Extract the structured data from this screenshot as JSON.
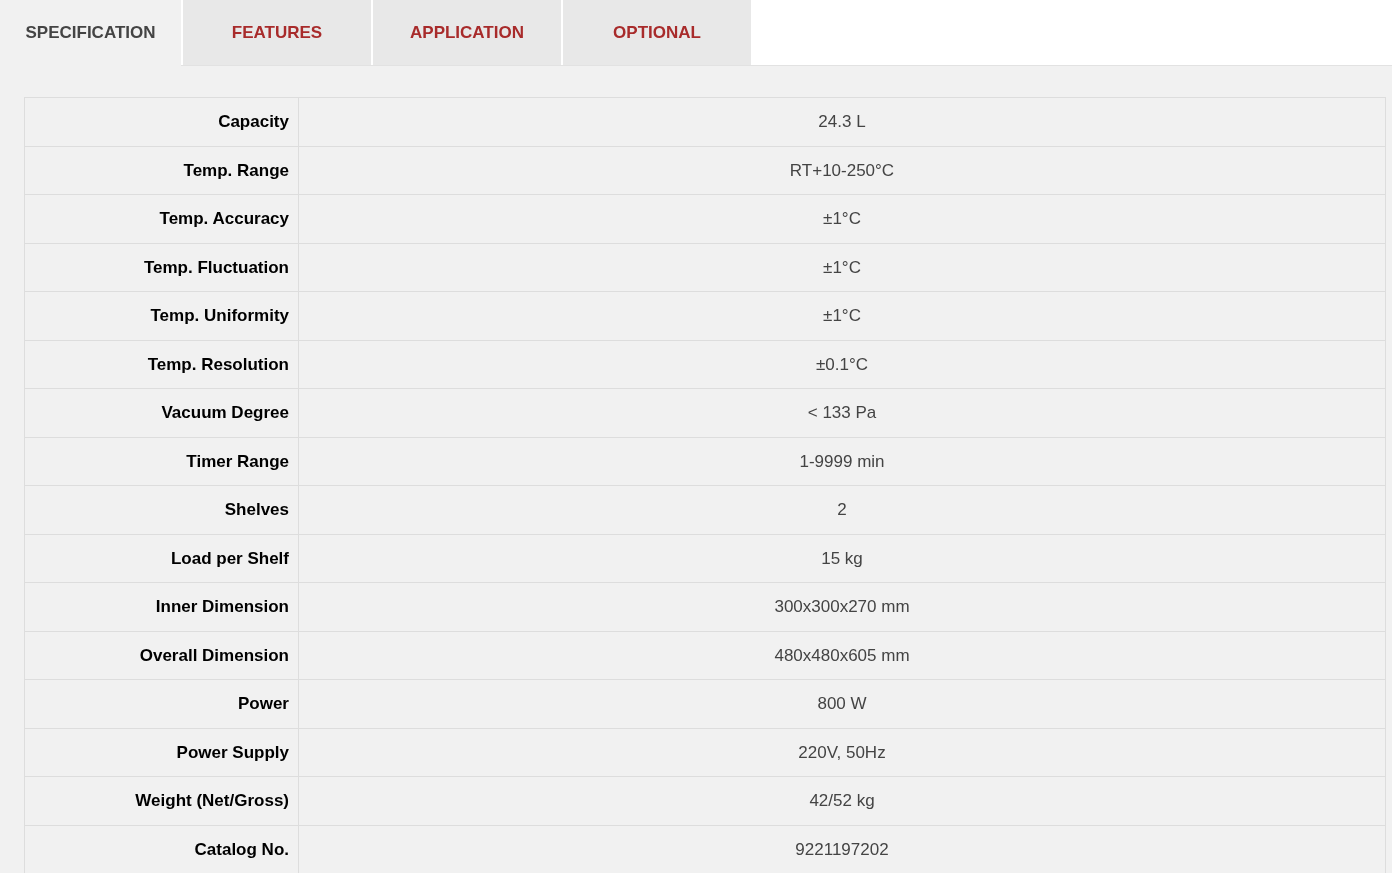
{
  "tabs": [
    {
      "label": "SPECIFICATION",
      "selected": true
    },
    {
      "label": "FEATURES",
      "selected": false
    },
    {
      "label": "APPLICATION",
      "selected": false
    },
    {
      "label": "OPTIONAL",
      "selected": false
    }
  ],
  "spec_table": {
    "rows": [
      {
        "label": "Capacity",
        "value": "24.3 L"
      },
      {
        "label": "Temp. Range",
        "value": "RT+10-250°C"
      },
      {
        "label": "Temp. Accuracy",
        "value": "±1°C"
      },
      {
        "label": "Temp. Fluctuation",
        "value": "±1°C"
      },
      {
        "label": "Temp. Uniformity",
        "value": "±1°C"
      },
      {
        "label": "Temp. Resolution",
        "value": "±0.1°C"
      },
      {
        "label": "Vacuum Degree",
        "value": "< 133 Pa"
      },
      {
        "label": "Timer Range",
        "value": "1-9999 min"
      },
      {
        "label": "Shelves",
        "value": "2"
      },
      {
        "label": "Load per Shelf",
        "value": "15 kg"
      },
      {
        "label": "Inner Dimension",
        "value": "300x300x270 mm"
      },
      {
        "label": "Overall Dimension",
        "value": "480x480x605 mm"
      },
      {
        "label": "Power",
        "value": "800 W"
      },
      {
        "label": "Power Supply",
        "value": "220V, 50Hz"
      },
      {
        "label": "Weight (Net/Gross)",
        "value": "42/52 kg"
      },
      {
        "label": "Catalog No.",
        "value": "9221197202"
      }
    ]
  }
}
